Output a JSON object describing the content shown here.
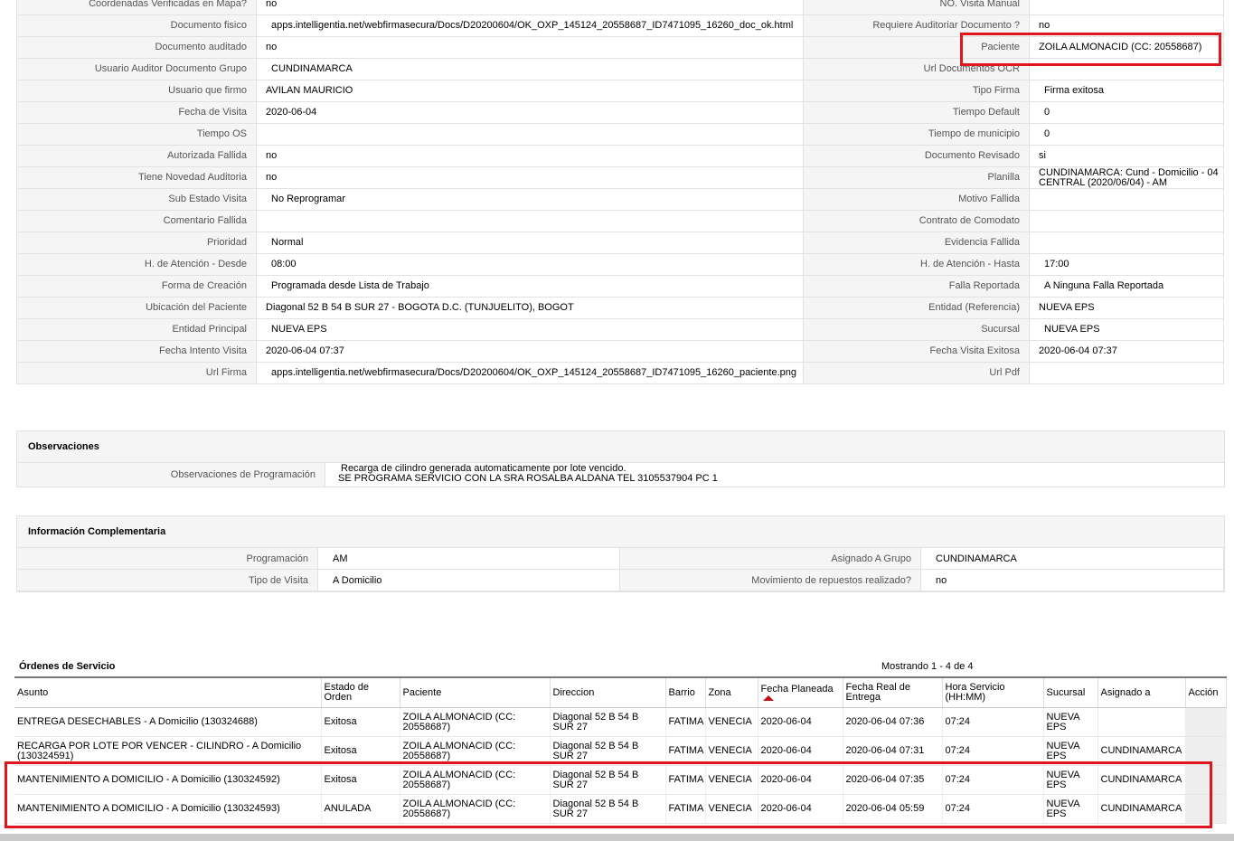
{
  "details": [
    [
      "Coordenadas Verificadas en Mapa?",
      "no",
      "NO. Visita Manual",
      ""
    ],
    [
      "Documento fisico",
      "apps.intelligentia.net/webfirmasecura/Docs/D20200604/OK_OXP_145124_20558687_ID7471095_16260_doc_ok.html",
      "Requiere Auditoriar Documento ?",
      "no"
    ],
    [
      "Documento auditado",
      "no",
      "Paciente",
      "ZOILA ALMONACID (CC: 20558687)"
    ],
    [
      "Usuario Auditor Documento Grupo",
      "CUNDINAMARCA",
      "Url Documentos OCR",
      ""
    ],
    [
      "Usuario que firmo",
      "AVILAN MAURICIO",
      "Tipo Firma",
      "Firma exitosa"
    ],
    [
      "Fecha de Visita",
      "2020-06-04",
      "Tiempo Default",
      "0"
    ],
    [
      "Tiempo OS",
      "",
      "Tiempo de municipio",
      "0"
    ],
    [
      "Autorizada Fallida",
      "no",
      "Documento Revisado",
      "si"
    ],
    [
      "Tiene Novedad Auditoria",
      "no",
      "Planilla",
      "CUNDINAMARCA: Cund - Domicilio - 04 CENTRAL (2020/06/04) - AM"
    ],
    [
      "Sub Estado Visita",
      "No Reprogramar",
      "Motivo Fallida",
      ""
    ],
    [
      "Comentario Fallida",
      "",
      "Contrato de Comodato",
      ""
    ],
    [
      "Prioridad",
      "Normal",
      "Evidencia Fallida",
      ""
    ],
    [
      "H. de Atención - Desde",
      "08:00",
      "H. de Atención - Hasta",
      "17:00"
    ],
    [
      "Forma de Creación",
      "Programada desde Lista de Trabajo",
      "Falla Reportada",
      "A Ninguna Falla Reportada"
    ],
    [
      "Ubicación del Paciente",
      "Diagonal 52 B 54 B SUR 27 - BOGOTA D.C. (TUNJUELITO), BOGOT",
      "Entidad (Referencia)",
      "NUEVA EPS"
    ],
    [
      "Entidad Principal",
      "NUEVA EPS",
      "Sucursal",
      "NUEVA EPS"
    ],
    [
      "Fecha Intento Visita",
      "2020-06-04 07:37",
      "Fecha Visita Exitosa",
      "2020-06-04 07:37"
    ],
    [
      "Url Firma",
      "apps.intelligentia.net/webfirmasecura/Docs/D20200604/OK_OXP_145124_20558687_ID7471095_16260_paciente.png",
      "Url Pdf",
      ""
    ]
  ],
  "observaciones": {
    "title": "Observaciones",
    "label": "Observaciones de Programación",
    "line1": "Recarga de cilindro generada automaticamente por lote vencido.",
    "line2": "SE PROGRAMA SERVICIO CON LA SRA ROSALBA ALDANA TEL 3105537904 PC 1"
  },
  "info": {
    "title": "Información Complementaria",
    "rows": [
      [
        "Programación",
        "AM",
        "Asignado A Grupo",
        "CUNDINAMARCA"
      ],
      [
        "Tipo de Visita",
        "A Domicilio",
        "Movimiento de repuestos realizado?",
        "no"
      ]
    ]
  },
  "orders": {
    "title": "Órdenes de Servicio",
    "count": "Mostrando 1 - 4 de 4",
    "headers": [
      "Asunto",
      "Estado de Orden",
      "Paciente",
      "Direccion",
      "Barrio",
      "Zona",
      "Fecha Planeada",
      "Fecha Real de Entrega",
      "Hora Servicio (HH:MM)",
      "Sucursal",
      "Asignado a",
      "Acción"
    ],
    "rows": [
      [
        "ENTREGA DESECHABLES - A Domicilio (130324688)",
        "Exitosa",
        "ZOILA ALMONACID (CC: 20558687)",
        "Diagonal 52 B 54 B SUR 27",
        "FATIMA",
        "VENECIA",
        "2020-06-04",
        "2020-06-04 07:36",
        "07:24",
        "NUEVA EPS",
        "",
        ""
      ],
      [
        "RECARGA POR LOTE POR VENCER - CILINDRO - A Domicilio (130324591)",
        "Exitosa",
        "ZOILA ALMONACID (CC: 20558687)",
        "Diagonal 52 B 54 B SUR 27",
        "FATIMA",
        "VENECIA",
        "2020-06-04",
        "2020-06-04 07:31",
        "07:24",
        "NUEVA EPS",
        "CUNDINAMARCA",
        ""
      ],
      [
        "MANTENIMIENTO A DOMICILIO - A Domicilio (130324592)",
        "Exitosa",
        "ZOILA ALMONACID (CC: 20558687)",
        "Diagonal 52 B 54 B SUR 27",
        "FATIMA",
        "VENECIA",
        "2020-06-04",
        "2020-06-04 07:35",
        "07:24",
        "NUEVA EPS",
        "CUNDINAMARCA",
        ""
      ],
      [
        "MANTENIMIENTO A DOMICILIO - A Domicilio (130324593)",
        "ANULADA",
        "ZOILA ALMONACID (CC: 20558687)",
        "Diagonal 52 B 54 B SUR 27",
        "FATIMA",
        "VENECIA",
        "2020-06-04",
        "2020-06-04 05:59",
        "07:24",
        "NUEVA EPS",
        "CUNDINAMARCA",
        ""
      ]
    ]
  },
  "colors": {
    "highlight": "#e0161c",
    "label_bg": "#f5f5f5",
    "sort_arrow": "#c01010"
  }
}
